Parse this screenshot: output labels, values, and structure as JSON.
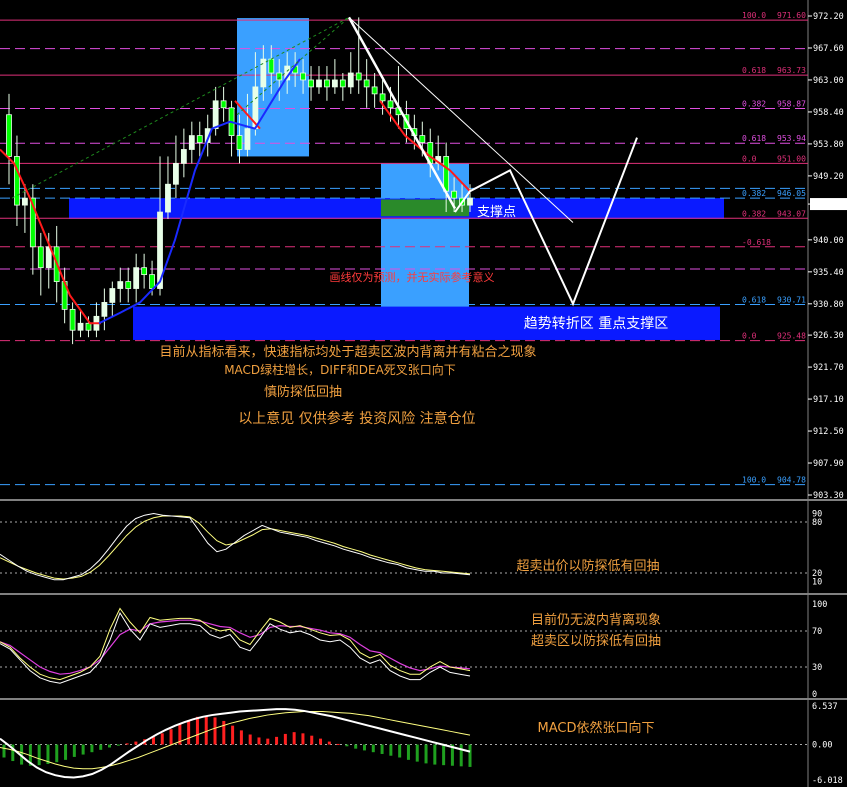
{
  "chart_data": {
    "type": "candlestick",
    "instrument_price": "945.15",
    "price_axis": {
      "ylim": [
        903.3,
        972.2
      ],
      "ticks": [
        "972.20",
        "967.60",
        "963.00",
        "958.40",
        "953.80",
        "949.20",
        "945.15",
        "940.00",
        "935.40",
        "930.80",
        "926.30",
        "921.70",
        "917.10",
        "912.50",
        "907.90",
        "903.30"
      ]
    },
    "fib_levels": [
      {
        "ratio": "100.0",
        "price": "971.60",
        "y": 971.6,
        "color": "#e0307a",
        "dash": false
      },
      {
        "ratio": "0.618",
        "price": "963.73",
        "y": 963.7,
        "color": "#e0307a",
        "dash": false
      },
      {
        "ratio": "0.382",
        "price": "958.87",
        "y": 958.9,
        "color": "#e04fe0",
        "dash": true
      },
      {
        "ratio": "0.618",
        "price": "953.94",
        "y": 953.9,
        "color": "#e04fe0",
        "dash": true
      },
      {
        "ratio": "0.0",
        "price": "951.00",
        "y": 951.0,
        "color": "#e0307a",
        "dash": false
      },
      {
        "ratio": "0.382",
        "price": "946.05",
        "y": 946.0,
        "color": "#3aa0ff",
        "dash": true
      },
      {
        "ratio": "0.382",
        "price": "943.07",
        "y": 943.1,
        "color": "#e0307a",
        "dash": false
      },
      {
        "ratio": "-0.618",
        "price": "",
        "y": 939.0,
        "color": "#e0307a",
        "dash": true
      },
      {
        "ratio": "0.618",
        "price": "930.71",
        "y": 930.7,
        "color": "#3aa0ff",
        "dash": true
      },
      {
        "ratio": "0.0",
        "price": "925.48",
        "y": 925.5,
        "color": "#e0307a",
        "dash": true
      },
      {
        "ratio": "100.0",
        "price": "904.78",
        "y": 904.8,
        "color": "#3aa0ff",
        "dash": true
      }
    ],
    "extra_dashed_levels": [
      967.5,
      935.8
    ],
    "candles": [
      [
        958,
        952,
        961,
        948
      ],
      [
        952,
        945,
        955,
        942
      ],
      [
        945,
        946,
        948,
        941
      ],
      [
        946,
        939,
        948,
        935
      ],
      [
        939,
        936,
        941,
        932
      ],
      [
        936,
        939,
        941,
        933
      ],
      [
        939,
        934,
        942,
        931
      ],
      [
        934,
        930,
        936,
        928
      ],
      [
        930,
        927,
        931,
        925
      ],
      [
        927,
        928,
        930,
        926
      ],
      [
        928,
        927,
        929,
        926
      ],
      [
        927,
        929,
        931,
        926
      ],
      [
        929,
        931,
        933,
        927
      ],
      [
        931,
        933,
        934,
        929
      ],
      [
        933,
        934,
        936,
        931
      ],
      [
        934,
        933,
        936,
        931
      ],
      [
        933,
        936,
        938,
        931
      ],
      [
        936,
        935,
        938,
        933
      ],
      [
        935,
        933,
        937,
        932
      ],
      [
        933,
        944,
        952,
        932
      ],
      [
        944,
        948,
        952,
        943
      ],
      [
        948,
        951,
        955,
        946
      ],
      [
        951,
        953,
        956,
        949
      ],
      [
        953,
        955,
        957,
        951
      ],
      [
        955,
        954,
        957,
        952
      ],
      [
        954,
        956,
        958,
        952
      ],
      [
        956,
        960,
        962,
        955
      ],
      [
        960,
        959,
        962,
        957
      ],
      [
        959,
        955,
        960,
        952
      ],
      [
        955,
        953,
        958,
        951
      ],
      [
        953,
        956,
        961,
        952
      ],
      [
        956,
        962,
        967,
        955
      ],
      [
        962,
        966,
        968,
        960
      ],
      [
        966,
        964,
        968,
        961
      ],
      [
        964,
        963,
        966,
        960
      ],
      [
        963,
        965,
        967,
        961
      ],
      [
        965,
        964,
        967,
        962
      ],
      [
        964,
        963,
        966,
        961
      ],
      [
        963,
        962,
        965,
        960
      ],
      [
        962,
        963,
        965,
        961
      ],
      [
        963,
        962,
        965,
        960
      ],
      [
        962,
        963,
        966,
        961
      ],
      [
        963,
        962,
        964,
        960
      ],
      [
        962,
        964,
        967,
        961
      ],
      [
        964,
        963,
        972,
        961
      ],
      [
        963,
        962,
        966,
        959
      ],
      [
        962,
        961,
        964,
        959
      ],
      [
        961,
        960,
        963,
        958
      ],
      [
        960,
        959,
        962,
        957
      ],
      [
        959,
        958,
        965,
        956
      ],
      [
        958,
        956,
        960,
        954
      ],
      [
        956,
        955,
        958,
        953
      ],
      [
        955,
        954,
        957,
        952
      ],
      [
        954,
        951,
        956,
        949
      ],
      [
        951,
        952,
        955,
        950
      ],
      [
        952,
        947,
        954,
        944
      ],
      [
        947,
        946,
        949,
        944
      ],
      [
        946,
        945,
        948,
        944
      ],
      [
        945,
        946,
        948,
        944
      ]
    ],
    "projection_path": [
      [
        957,
        952
      ],
      [
        999,
        947
      ],
      [
        1049,
        951
      ],
      [
        1091,
        931
      ],
      [
        1146,
        955
      ]
    ],
    "annotations_price": [
      "画线仅为预测，并无实际参考意义",
      "支撑点",
      "趋势转折区 重点支撑区"
    ],
    "commentary_lines": [
      "目前从指标看来，快速指标均处于超卖区波内背离并有粘合之现象",
      "MACD绿柱增长，DIFF和DEA死叉张口向下",
      "慎防探低回抽",
      "以上意见 仅供参考 投资风险 注意仓位"
    ],
    "stoch_panel": {
      "ticks": [
        "90",
        "80",
        "20",
        "10"
      ],
      "comment": "超卖出价以防探低有回抽",
      "k": [
        42,
        35,
        28,
        22,
        18,
        15,
        12,
        12,
        15,
        18,
        25,
        35,
        48,
        62,
        75,
        84,
        88,
        90,
        88,
        87,
        86,
        85,
        70,
        55,
        45,
        48,
        56,
        64,
        70,
        76,
        72,
        68,
        66,
        64,
        62,
        58,
        55,
        52,
        48,
        45,
        42,
        38,
        35,
        32,
        30,
        26,
        24,
        22,
        22,
        20,
        20,
        19,
        18
      ],
      "d": [
        38,
        33,
        28,
        24,
        20,
        17,
        14,
        13,
        14,
        16,
        21,
        29,
        40,
        52,
        64,
        74,
        81,
        85,
        87,
        87,
        87,
        86,
        79,
        68,
        58,
        53,
        55,
        60,
        65,
        71,
        72,
        70,
        68,
        66,
        64,
        61,
        58,
        55,
        51,
        48,
        45,
        41,
        38,
        35,
        32,
        29,
        26,
        24,
        23,
        22,
        21,
        20,
        19
      ]
    },
    "rsi_panel": {
      "ticks": [
        "100",
        "70",
        "30",
        "0"
      ],
      "comment_lines": [
        "目前仍无波内背离现象",
        "超卖区以防探低有回抽"
      ],
      "a": [
        58,
        52,
        40,
        30,
        22,
        18,
        16,
        20,
        24,
        30,
        42,
        72,
        95,
        80,
        68,
        85,
        82,
        83,
        84,
        84,
        82,
        74,
        70,
        72,
        60,
        55,
        70,
        84,
        80,
        74,
        76,
        72,
        68,
        65,
        66,
        60,
        46,
        40,
        44,
        32,
        26,
        22,
        22,
        30,
        36,
        30,
        28,
        26
      ],
      "b": [
        58,
        54,
        46,
        38,
        30,
        25,
        22,
        23,
        26,
        30,
        38,
        52,
        66,
        72,
        70,
        78,
        80,
        81,
        82,
        82,
        81,
        78,
        75,
        74,
        68,
        63,
        66,
        74,
        76,
        75,
        75,
        73,
        71,
        68,
        67,
        63,
        55,
        48,
        46,
        40,
        34,
        29,
        26,
        28,
        31,
        30,
        29,
        28
      ],
      "c": [
        56,
        50,
        38,
        26,
        18,
        14,
        12,
        16,
        20,
        24,
        36,
        60,
        90,
        72,
        60,
        78,
        74,
        76,
        78,
        78,
        76,
        66,
        62,
        66,
        52,
        48,
        62,
        78,
        72,
        68,
        70,
        66,
        60,
        58,
        60,
        52,
        40,
        34,
        38,
        26,
        20,
        16,
        16,
        24,
        30,
        24,
        22,
        20
      ]
    },
    "macd_panel": {
      "ticks": [
        "6.537",
        "0.00",
        "-6.018"
      ],
      "comment": "MACD依然张口向下",
      "hist": [
        -2.2,
        -2.8,
        -3.4,
        -3.6,
        -3.5,
        -3.3,
        -3.0,
        -2.6,
        -2.1,
        -1.7,
        -1.3,
        -0.9,
        -0.5,
        -0.2,
        0.2,
        0.5,
        0.9,
        1.3,
        1.9,
        2.6,
        3.4,
        4.1,
        4.7,
        4.9,
        4.6,
        4.0,
        3.2,
        2.4,
        1.7,
        1.2,
        1.0,
        1.3,
        1.8,
        2.1,
        1.9,
        1.5,
        1.0,
        0.5,
        0.1,
        -0.3,
        -0.7,
        -1.0,
        -1.3,
        -1.6,
        -1.9,
        -2.2,
        -2.6,
        -2.9,
        -3.2,
        -3.4,
        -3.5,
        -3.6,
        -3.7,
        -3.8
      ],
      "diff": [
        1.0,
        -0.2,
        -1.5,
        -2.8,
        -3.9,
        -4.7,
        -5.2,
        -5.5,
        -5.6,
        -5.4,
        -5.0,
        -4.3,
        -3.4,
        -2.3,
        -1.2,
        -0.2,
        0.8,
        1.7,
        2.5,
        3.2,
        3.8,
        4.3,
        4.7,
        5.0,
        5.2,
        5.4,
        5.6,
        5.7,
        5.8,
        5.9,
        6.0,
        6.0,
        5.9,
        5.7,
        5.4,
        5.1,
        4.8,
        4.4,
        4.0,
        3.6,
        3.2,
        2.8,
        2.4,
        2.0,
        1.6,
        1.2,
        0.8,
        0.4,
        0.0,
        -0.4,
        -0.8,
        -1.2
      ],
      "dea": [
        -0.5,
        -0.8,
        -1.2,
        -1.7,
        -2.3,
        -2.8,
        -3.3,
        -3.7,
        -4.0,
        -4.1,
        -4.1,
        -3.9,
        -3.6,
        -3.2,
        -2.7,
        -2.2,
        -1.6,
        -1.0,
        -0.4,
        0.2,
        0.8,
        1.4,
        2.0,
        2.6,
        3.1,
        3.6,
        4.0,
        4.4,
        4.7,
        5.0,
        5.2,
        5.4,
        5.5,
        5.6,
        5.6,
        5.6,
        5.5,
        5.4,
        5.3,
        5.1,
        4.9,
        4.6,
        4.3,
        4.0,
        3.7,
        3.4,
        3.1,
        2.8,
        2.5,
        2.2,
        1.9,
        1.6
      ]
    }
  }
}
